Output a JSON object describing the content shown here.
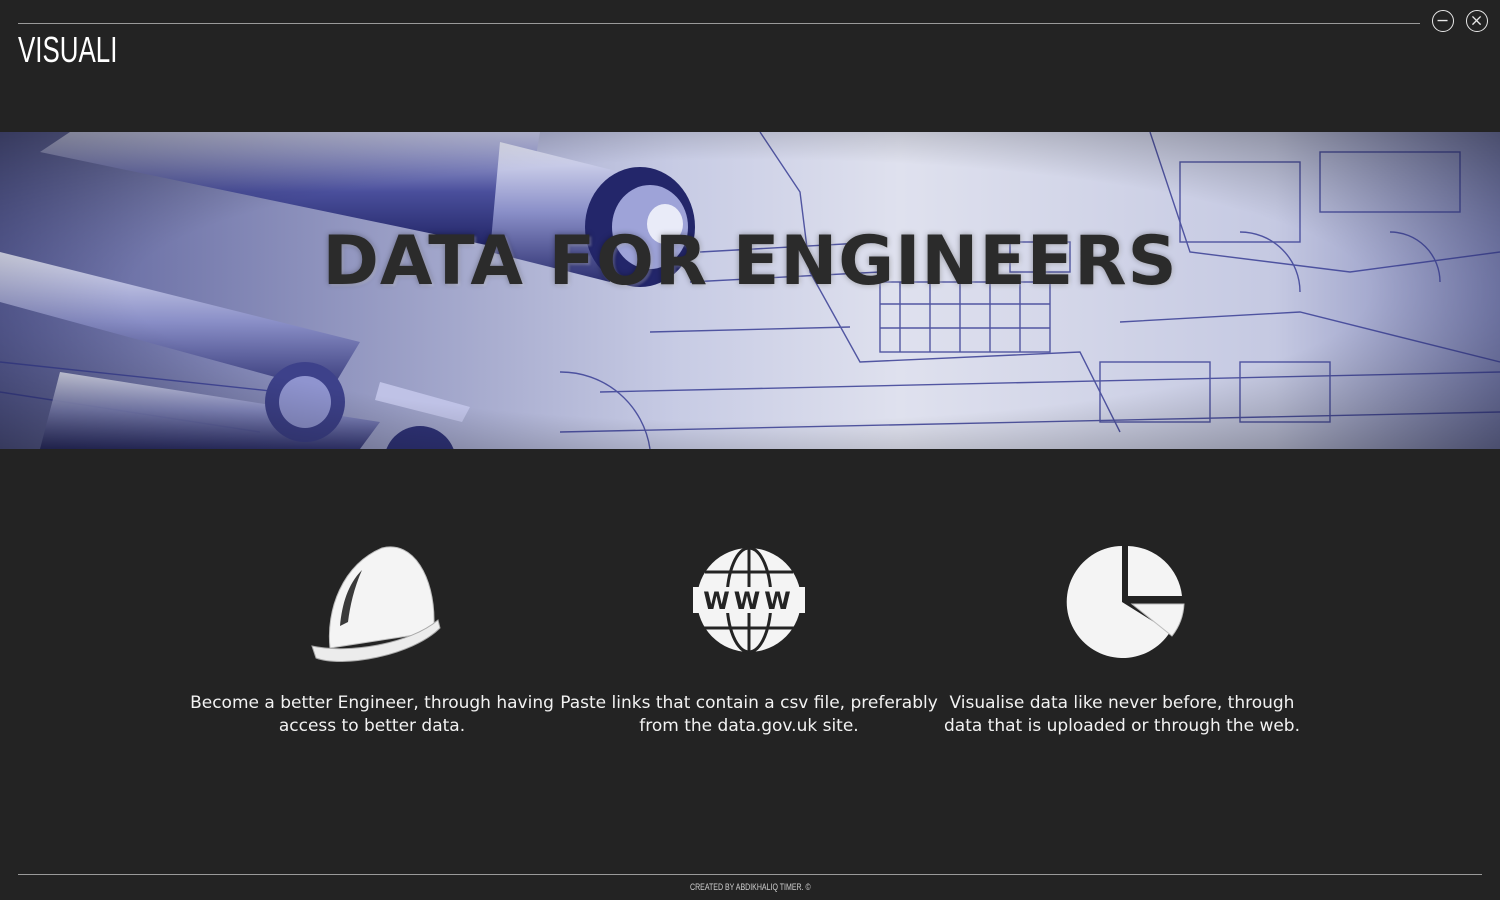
{
  "app": {
    "title": "VISUALI"
  },
  "window_controls": {
    "minimize_icon": "minus-circle-icon",
    "close_icon": "x-circle-icon"
  },
  "hero": {
    "title": "DATA FOR ENGINEERS",
    "image": "engineering-blueprint-with-compass-and-pen"
  },
  "features": [
    {
      "icon": "hard-hat-icon",
      "text": "Become a better Engineer, through having access to better data."
    },
    {
      "icon": "globe-www-icon",
      "text": "Paste links that contain a csv file, preferably from the data.gov.uk site."
    },
    {
      "icon": "pie-chart-icon",
      "text": "Visualise data like never before, through data that is uploaded or through the web."
    }
  ],
  "footer": {
    "credit": "Created by Abdikhaliq Timer.",
    "copyright_symbol": "©"
  },
  "colors": {
    "background": "#232323",
    "text": "#ffffff",
    "hero_tint": "#5a5fa8",
    "hero_title": "#2b2b2b"
  }
}
